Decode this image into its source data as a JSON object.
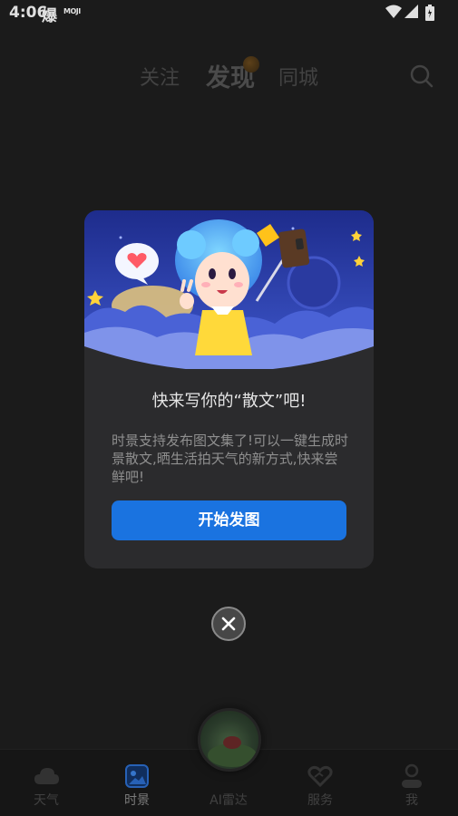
{
  "status_bar": {
    "time": "4:06",
    "app_icon_char": "爆",
    "app_moji": "MOJI",
    "icons": [
      "wifi-icon",
      "signal-icon",
      "battery-icon"
    ]
  },
  "header": {
    "tabs": [
      {
        "label": "关注",
        "active": false
      },
      {
        "label": "发现",
        "active": true
      },
      {
        "label": "同城",
        "active": false
      }
    ],
    "search_icon": "search-icon"
  },
  "modal": {
    "title": "快来写你的“散文”吧!",
    "description": "时景支持发布图文集了!可以一键生成时景散文,晒生活拍天气的新方式,快来尝鲜吧!",
    "button_label": "开始发图",
    "close_icon": "close-icon"
  },
  "bottom_nav": {
    "items": [
      {
        "label": "天气",
        "icon": "cloud-icon",
        "active": false
      },
      {
        "label": "时景",
        "icon": "photo-icon",
        "active": true
      },
      {
        "label": "AI雷达",
        "icon": "radar-icon",
        "active": false
      },
      {
        "label": "服务",
        "icon": "heart-hand-icon",
        "active": false
      },
      {
        "label": "我",
        "icon": "user-icon",
        "active": false
      }
    ]
  },
  "colors": {
    "background": "#1f1f1f",
    "modal_bg": "#2b2b2d",
    "primary_button": "#1a73e0",
    "banner_blue": "#2a3fa6"
  }
}
